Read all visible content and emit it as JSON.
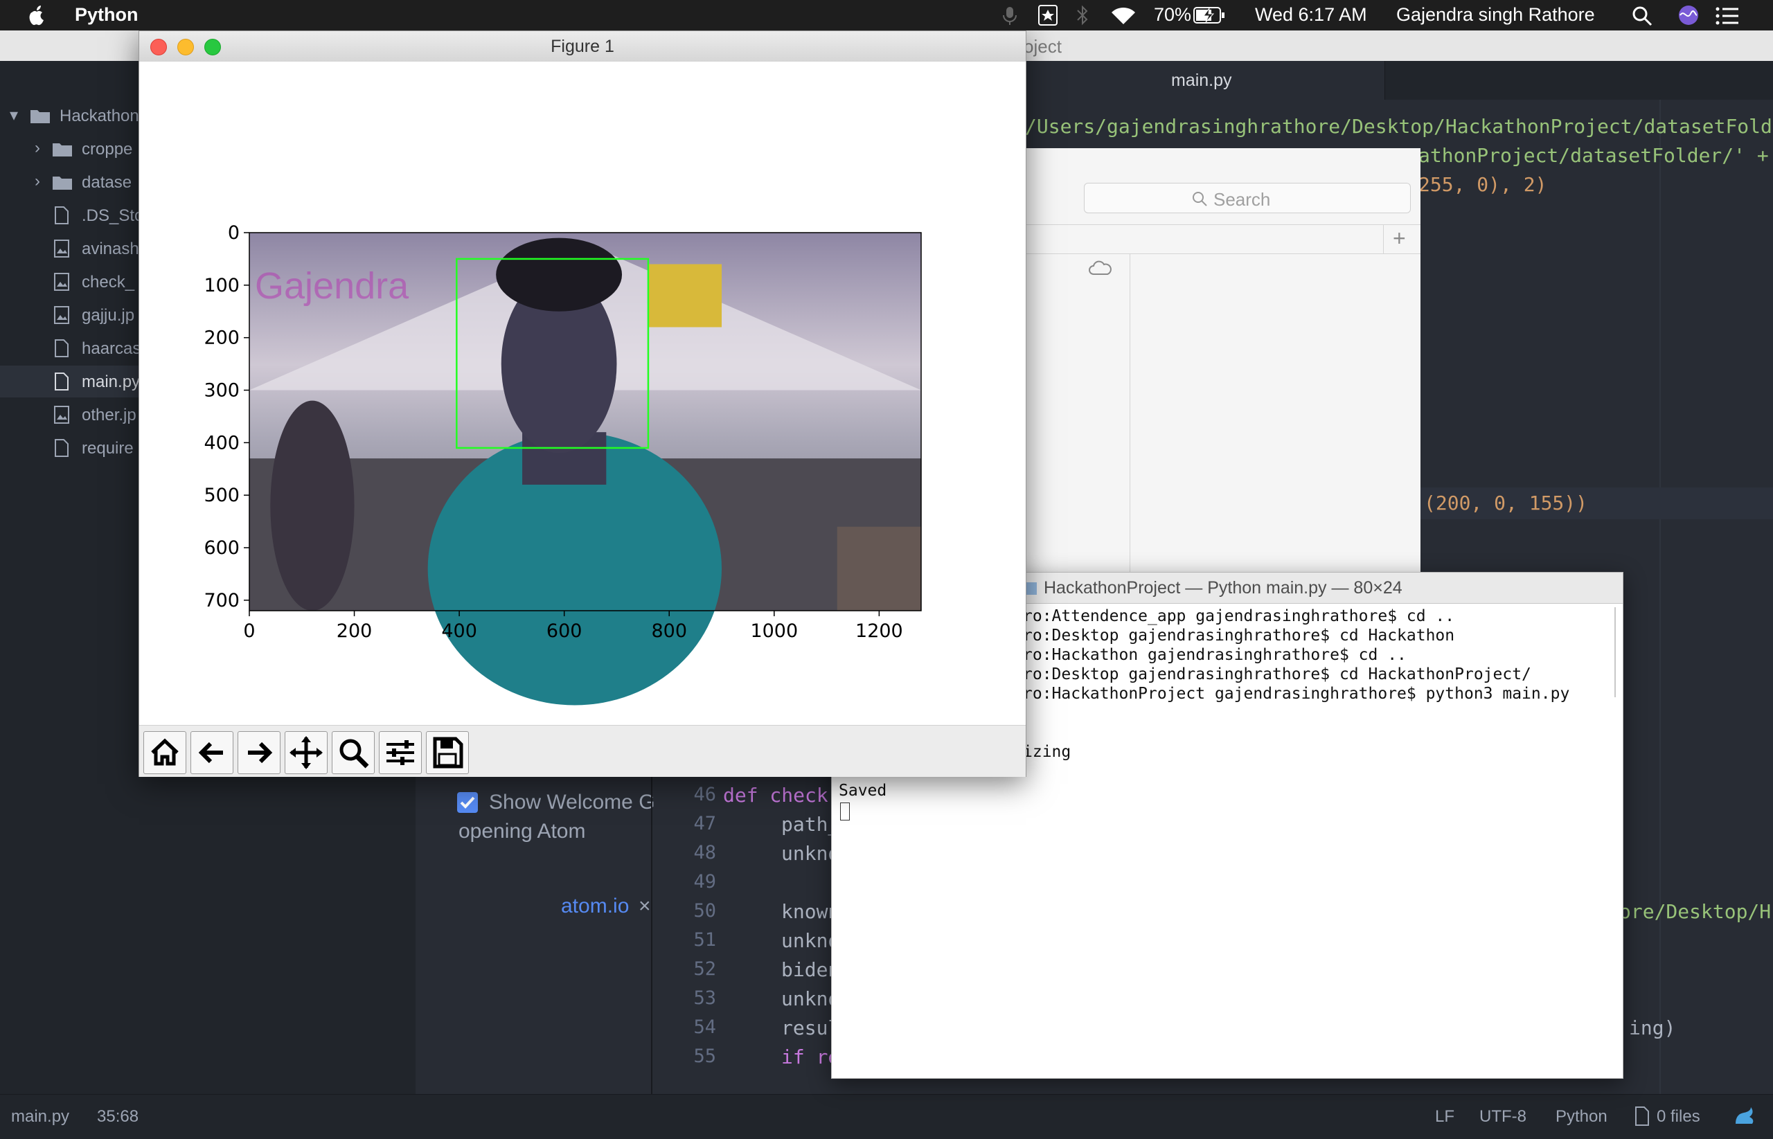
{
  "menubar": {
    "app": "Python",
    "battery": "70%",
    "clock": "Wed 6:17 AM",
    "user": "Gajendra singh Rathore"
  },
  "atom": {
    "title_fragment": "oject",
    "tab": "main.py",
    "tree": {
      "root": "Hackathon",
      "items": [
        "croppe",
        "datase",
        ".DS_Sto",
        "avinash",
        "check_",
        "gajju.jp",
        "haarcas",
        "main.py",
        "other.jp",
        "require"
      ]
    },
    "code_top": [
      "/Users/gajendrasinghrathore/Desktop/HackathonProject/datasetFolde",
      "athonProject/datasetFolder/' +",
      "255, 0), 2)",
      "(200, 0, 155))"
    ],
    "gutter": [
      "46",
      "47",
      "48",
      "49",
      "50",
      "51",
      "52",
      "53",
      "54",
      "55"
    ],
    "code_lines": [
      "def check",
      "path_",
      "unkno",
      "",
      "known",
      "unkno",
      "biden",
      "unkno",
      "resul",
      "if re"
    ],
    "right_fragments": [
      "ore/Desktop/H",
      "ing)"
    ],
    "welcome": {
      "checkbox_label": "Show Welcome G",
      "checkbox_label2": "opening Atom",
      "link": "atom.io",
      "close": "×"
    },
    "status": {
      "file": "main.py",
      "cursor": "35:68",
      "line_ending": "LF",
      "encoding": "UTF-8",
      "grammar": "Python",
      "files": "0 files"
    }
  },
  "finder": {
    "search_placeholder": "Search"
  },
  "terminal": {
    "title": "HackathonProject — Python main.py — 80×24",
    "lines": [
      "ro:Attendence_app gajendrasinghrathore$ cd ..",
      "ro:Desktop gajendrasinghrathore$ cd Hackathon",
      "ro:Hackathon gajendrasinghrathore$ cd ..",
      "ro:Desktop gajendrasinghrathore$ cd HackathonProject/",
      "ro:HackathonProject gajendrasinghrathore$ python3 main.py",
      "",
      "",
      "izing",
      "",
      "Saved"
    ]
  },
  "figure": {
    "title": "Figure 1",
    "overlay_text": "Gajendra",
    "chart_data": {
      "type": "image",
      "xlim": [
        0,
        1280
      ],
      "ylim": [
        720,
        0
      ],
      "xticks": [
        0,
        200,
        400,
        600,
        800,
        1000,
        1200
      ],
      "yticks": [
        0,
        100,
        200,
        300,
        400,
        500,
        600,
        700
      ],
      "xlabel": "",
      "ylabel": "",
      "detection_box": {
        "x0": 395,
        "y0": 50,
        "x1": 760,
        "y1": 410
      },
      "label": "Gajendra"
    },
    "toolbar": [
      "home-icon",
      "back-icon",
      "forward-icon",
      "pan-icon",
      "zoom-icon",
      "configure-icon",
      "save-icon"
    ]
  }
}
